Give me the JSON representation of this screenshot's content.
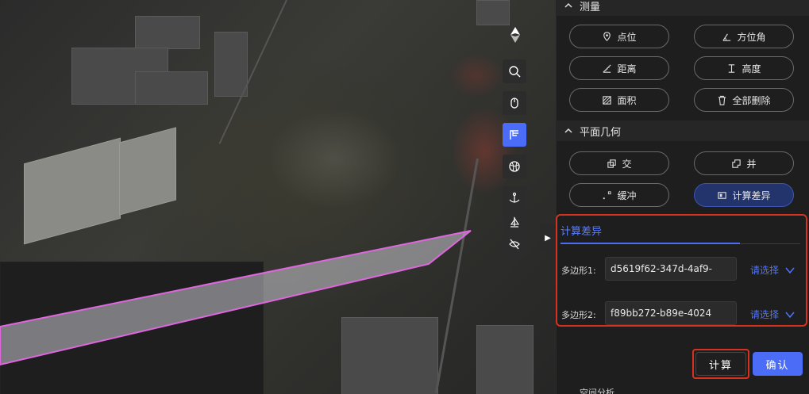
{
  "map": {
    "tools": [
      {
        "icon": "search-icon"
      },
      {
        "icon": "mouse-icon"
      },
      {
        "icon": "plane-geometry-icon",
        "active": true
      },
      {
        "icon": "globe-icon"
      },
      {
        "icon": "anchor-icon"
      },
      {
        "icon": "sail-icon"
      },
      {
        "icon": "eye-off-icon"
      }
    ],
    "polygon_colors": {
      "fill": "#c8c8d0",
      "stroke": "#e066e0"
    }
  },
  "panel": {
    "measure": {
      "title": "测量",
      "buttons": [
        {
          "label": "点位",
          "icon": "location-pin-icon"
        },
        {
          "label": "方位角",
          "icon": "angle-icon"
        },
        {
          "label": "距离",
          "icon": "ruler-icon"
        },
        {
          "label": "高度",
          "icon": "height-icon"
        },
        {
          "label": "面积",
          "icon": "area-icon"
        },
        {
          "label": "全部删除",
          "icon": "trash-icon"
        }
      ]
    },
    "geometry": {
      "title": "平面几何",
      "buttons": [
        {
          "label": "交",
          "icon": "intersect-icon"
        },
        {
          "label": "并",
          "icon": "union-icon"
        },
        {
          "label": "缓冲",
          "icon": "buffer-icon"
        },
        {
          "label": "计算差异",
          "icon": "difference-icon",
          "active": true
        }
      ]
    },
    "calc": {
      "tab_title": "计算差异",
      "polygon1_label": "多边形1:",
      "polygon1_value": "d5619f62-347d-4af9-",
      "polygon2_label": "多边形2:",
      "polygon2_value": "f89bb272-b89e-4024",
      "select_label": "请选择",
      "compute_label": "计算",
      "confirm_label": "确认"
    },
    "next_section_partial": "空间分析"
  },
  "colors": {
    "accent": "#4a6cf7",
    "highlight": "#d5331f"
  }
}
